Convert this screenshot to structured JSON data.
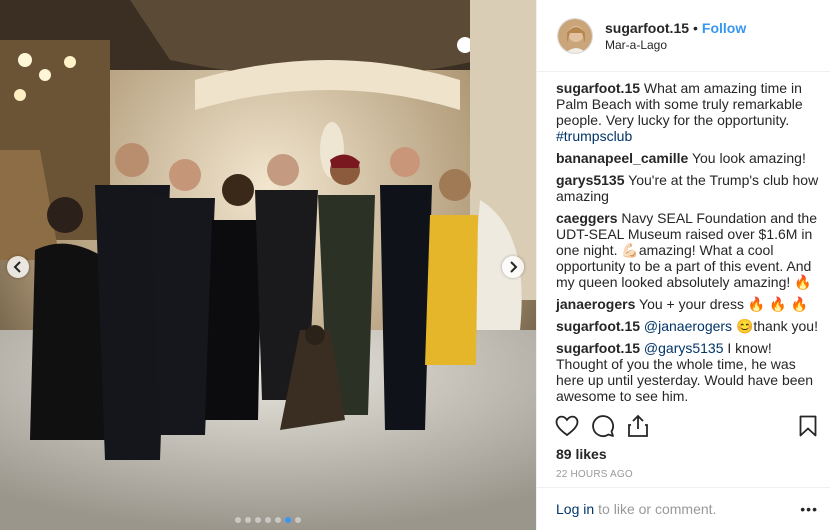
{
  "post": {
    "username": "sugarfoot.15",
    "separator": "•",
    "follow_label": "Follow",
    "location": "Mar-a-Lago"
  },
  "comments": [
    {
      "user": "sugarfoot.15",
      "text": "What am amazing time in Palm Beach with some truly remarkable people. Very lucky for the opportunity.",
      "hashtag": "#trumpsclub"
    },
    {
      "user": "bananapeel_camille",
      "text": "You look amazing!"
    },
    {
      "user": "garys5135",
      "text": "You're at the Trump's club how amazing"
    },
    {
      "user": "caeggers",
      "text": "Navy SEAL Foundation and the UDT-SEAL Museum raised over $1.6M in one night. 💪🏻amazing! What a cool opportunity to be a part of this event. And my queen looked absolutely amazing! 🔥"
    },
    {
      "user": "janaerogers",
      "text": "You + your dress 🔥 🔥 🔥"
    },
    {
      "user": "sugarfoot.15",
      "mention": "@janaerogers",
      "text": "😊thank you!"
    },
    {
      "user": "sugarfoot.15",
      "mention": "@garys5135",
      "text": "I know! Thought of you the whole time, he was here up until yesterday. Would have been awesome to see him."
    }
  ],
  "stats": {
    "likes": "89 likes",
    "timestamp": "22 HOURS AGO"
  },
  "footer": {
    "login_link": "Log in",
    "login_suffix": "to like or comment.",
    "more": "•••"
  },
  "icons": {
    "like": "heart-icon",
    "comment": "comment-icon",
    "share": "share-icon",
    "save": "bookmark-icon",
    "prev": "chevron-left-icon",
    "next": "chevron-right-icon"
  },
  "carousel": {
    "slides": 7,
    "active": 6
  },
  "colors": {
    "link": "#3897f0",
    "hashtag": "#003569",
    "muted": "#999999",
    "text": "#262626"
  }
}
